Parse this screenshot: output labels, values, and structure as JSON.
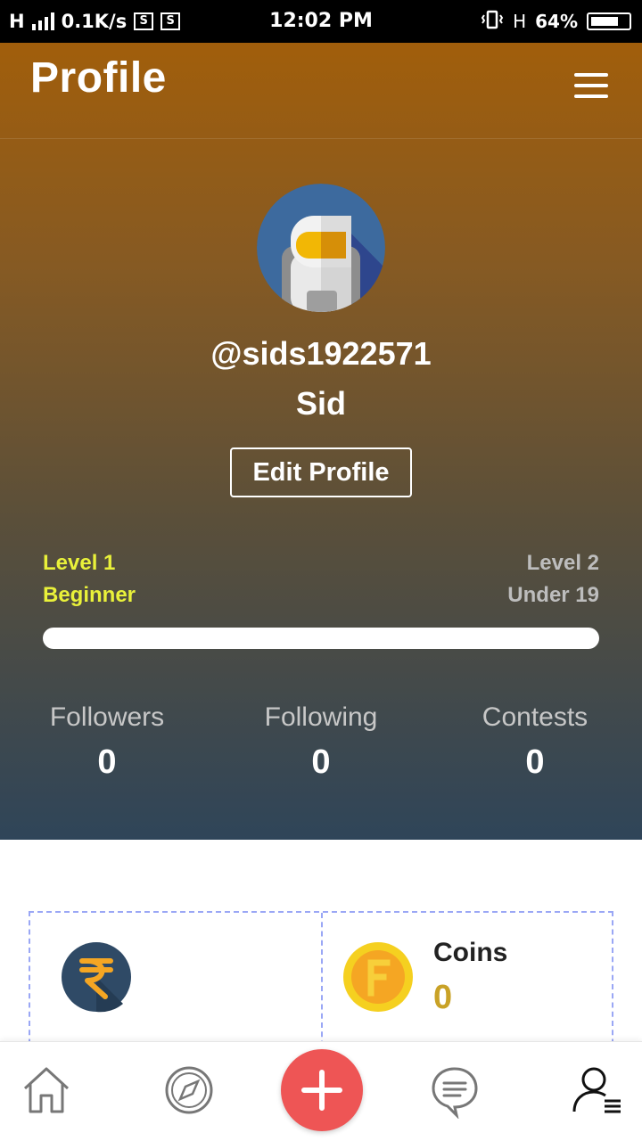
{
  "status_bar": {
    "network_type": "H",
    "speed": "0.1K/s",
    "time": "12:02 PM",
    "network_type_right": "H",
    "battery": "64%"
  },
  "header": {
    "title": "Profile",
    "menu_icon": "hamburger-menu-icon"
  },
  "profile": {
    "avatar_icon": "astronaut-avatar-icon",
    "username": "@sids1922571",
    "display_name": "Sid",
    "edit_button_label": "Edit Profile"
  },
  "level": {
    "current_level": "Level 1",
    "current_rank": "Beginner",
    "next_level": "Level 2",
    "next_rank": "Under 19",
    "progress": 0,
    "current_color": "#e9f13a"
  },
  "stats": [
    {
      "label": "Followers",
      "value": "0"
    },
    {
      "label": "Following",
      "value": "0"
    },
    {
      "label": "Contests",
      "value": "0"
    }
  ],
  "wallet": {
    "rupee_icon": "rupee-icon",
    "coins_icon": "coin-icon",
    "coins_label": "Coins",
    "coins_value": "0"
  },
  "bottom_nav": {
    "items": [
      "home-icon",
      "compass-icon",
      "add-icon",
      "chat-icon",
      "profile-menu-icon"
    ],
    "fab_color": "#ee5555"
  }
}
